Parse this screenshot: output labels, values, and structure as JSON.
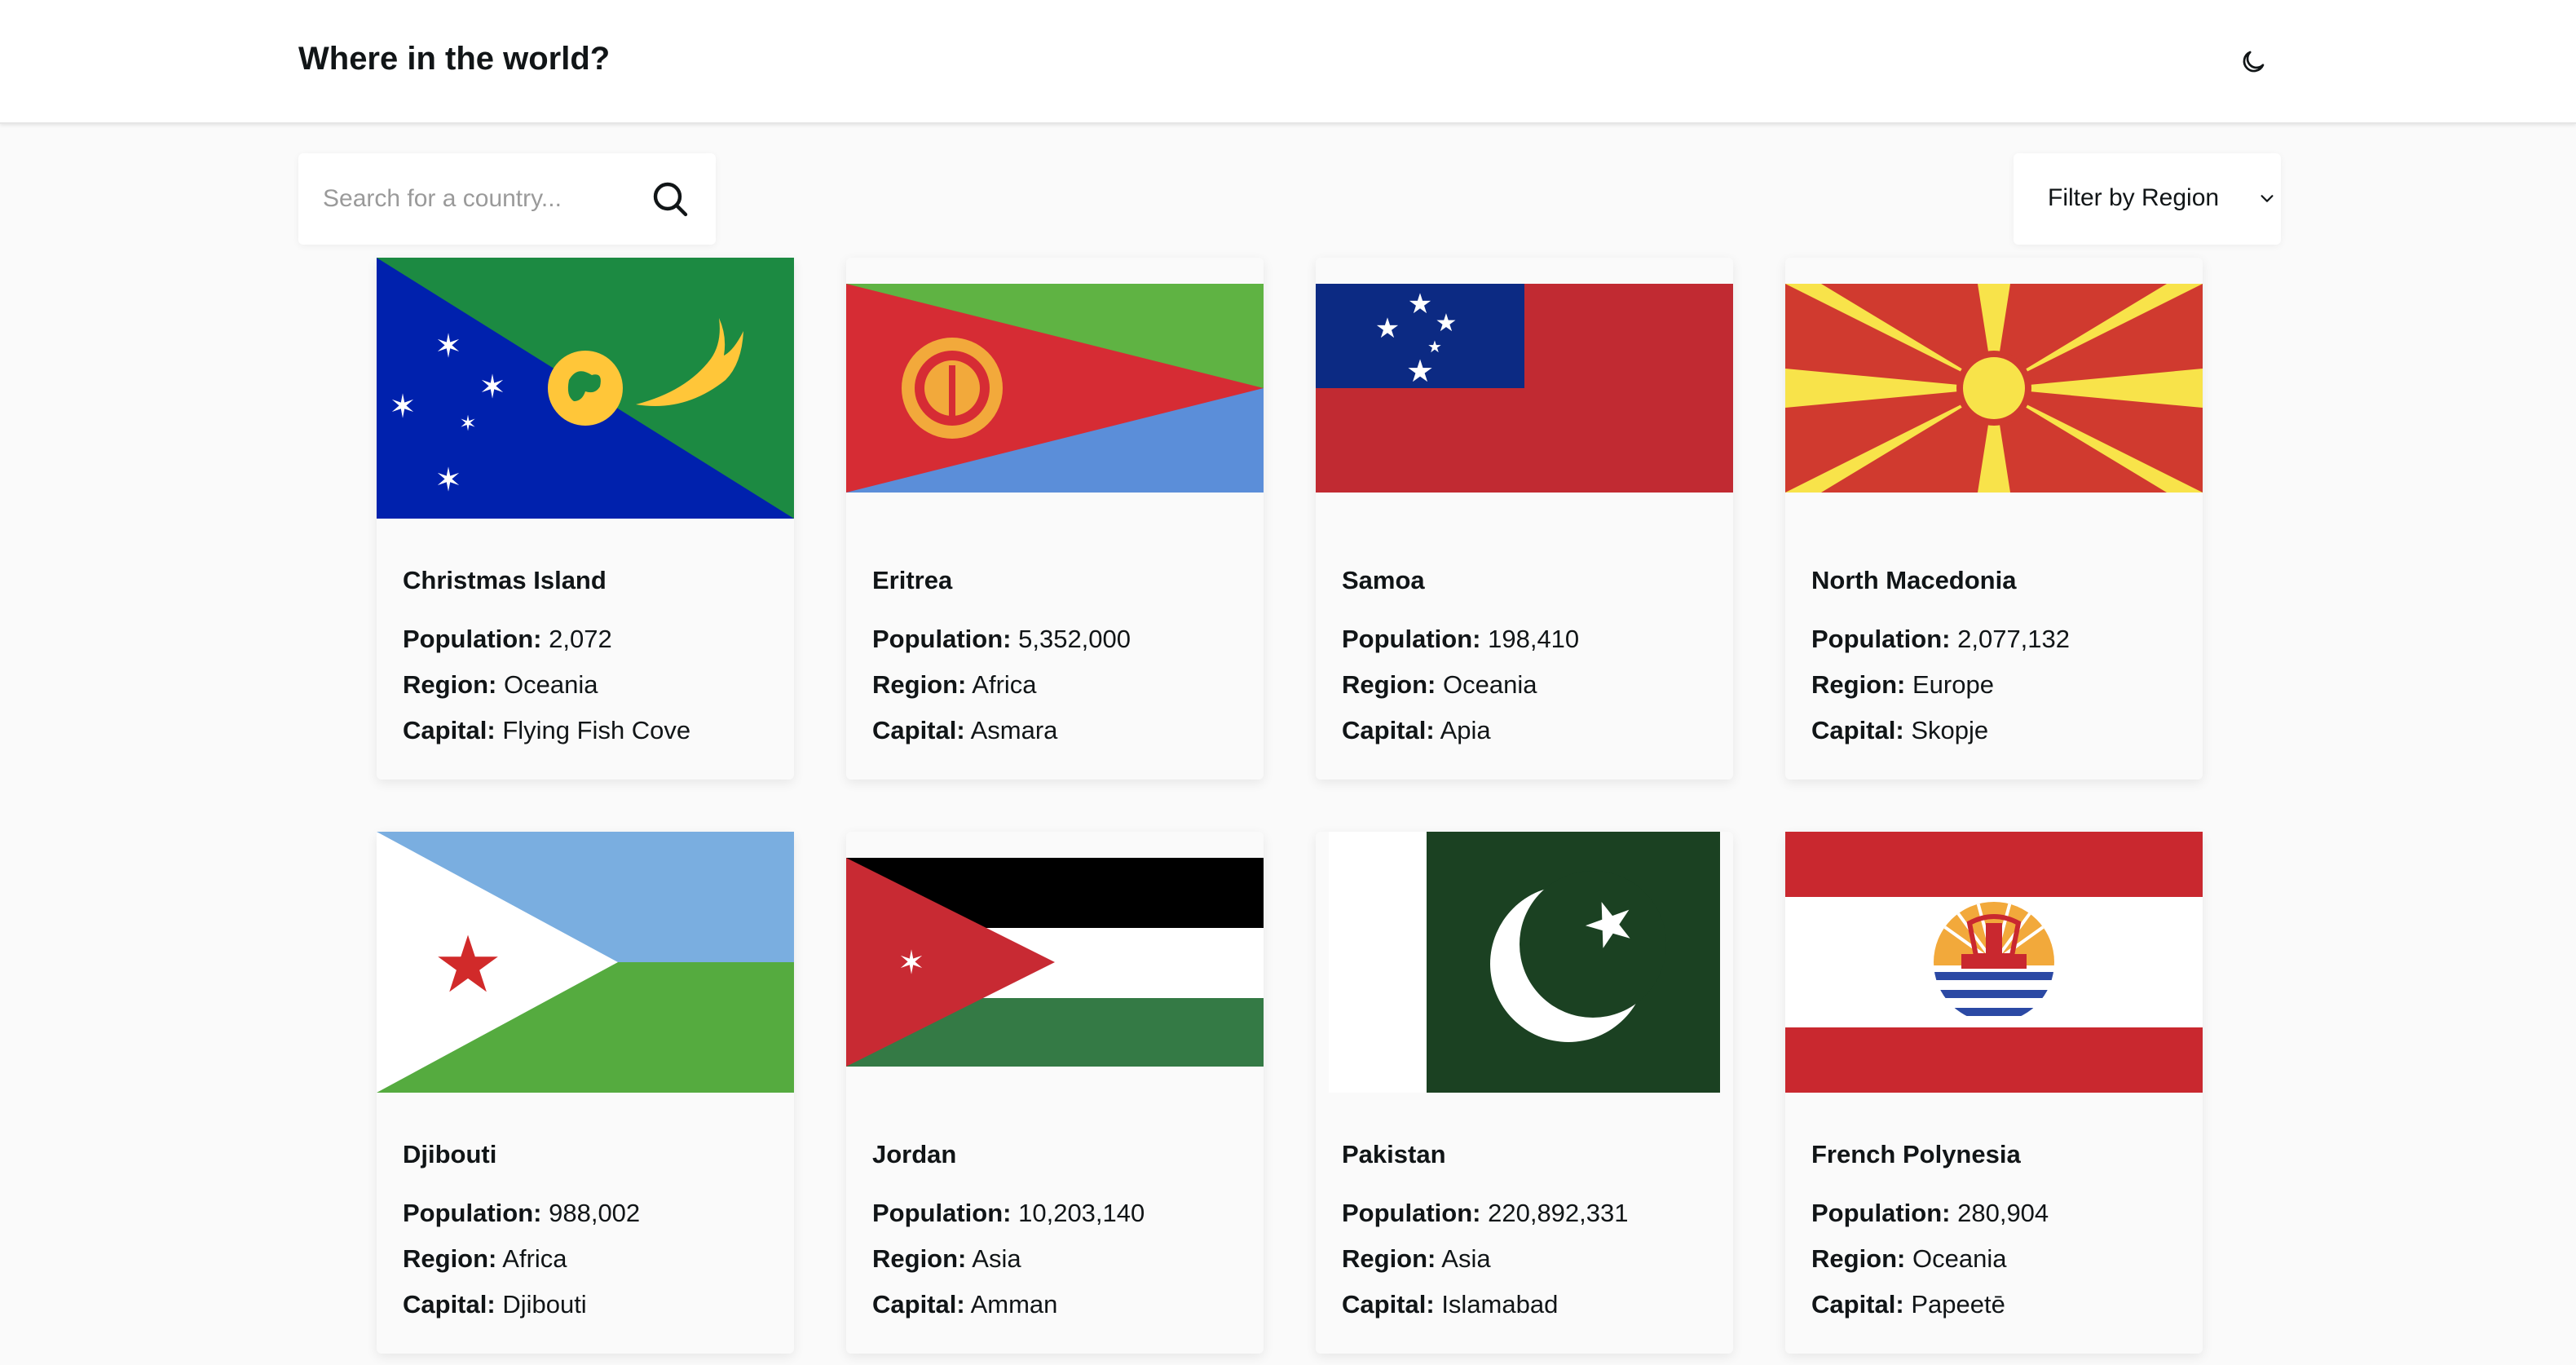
{
  "header": {
    "title": "Where in the world?",
    "theme_icon": "moon-icon"
  },
  "search": {
    "placeholder": "Search for a country...",
    "value": "",
    "icon": "search-icon"
  },
  "filter": {
    "label": "Filter by Region",
    "icon": "chevron-down-icon"
  },
  "labels": {
    "population": "Population:",
    "region": "Region:",
    "capital": "Capital:"
  },
  "countries": [
    {
      "name": "Christmas Island",
      "population": "2,072",
      "region": "Oceania",
      "capital": "Flying Fish Cove",
      "flag": "christmas-island-flag"
    },
    {
      "name": "Eritrea",
      "population": "5,352,000",
      "region": "Africa",
      "capital": "Asmara",
      "flag": "eritrea-flag"
    },
    {
      "name": "Samoa",
      "population": "198,410",
      "region": "Oceania",
      "capital": "Apia",
      "flag": "samoa-flag"
    },
    {
      "name": "North Macedonia",
      "population": "2,077,132",
      "region": "Europe",
      "capital": "Skopje",
      "flag": "north-macedonia-flag"
    },
    {
      "name": "Djibouti",
      "population": "988,002",
      "region": "Africa",
      "capital": "Djibouti",
      "flag": "djibouti-flag"
    },
    {
      "name": "Jordan",
      "population": "10,203,140",
      "region": "Asia",
      "capital": "Amman",
      "flag": "jordan-flag"
    },
    {
      "name": "Pakistan",
      "population": "220,892,331",
      "region": "Asia",
      "capital": "Islamabad",
      "flag": "pakistan-flag"
    },
    {
      "name": "French Polynesia",
      "population": "280,904",
      "region": "Oceania",
      "capital": "Papeetē",
      "flag": "french-polynesia-flag"
    }
  ]
}
